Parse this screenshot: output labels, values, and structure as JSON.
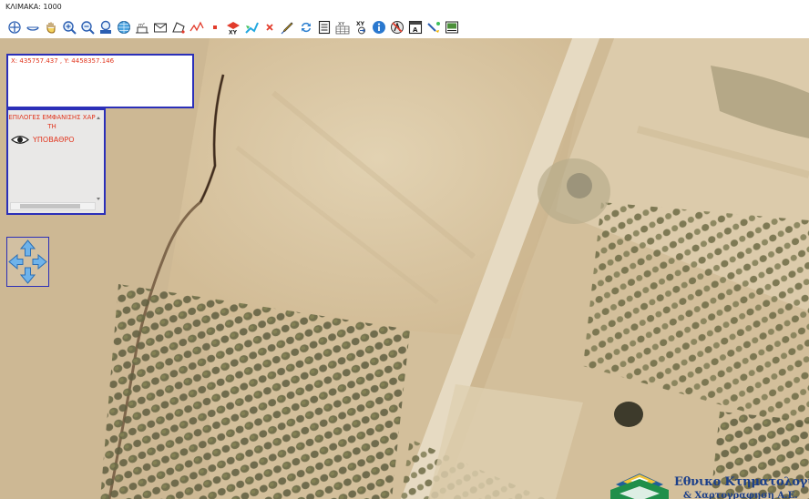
{
  "scale": {
    "text": "ΚΛΙΜΑΚΑ: 1000"
  },
  "toolbar": {
    "tools": [
      "pan-icon",
      "rotate-icon",
      "hand-icon",
      "zoom-in-icon",
      "zoom-out-icon",
      "zoom-previous-icon",
      "globe-icon",
      "measure-area-icon",
      "envelope-icon",
      "polygon-icon",
      "polyline-icon",
      "point-icon",
      "goto-xy-icon",
      "draw-vector-icon",
      "clear-icon",
      "edit-icon",
      "refresh-icon",
      "document-icon",
      "xy-table-icon",
      "xy-export-icon",
      "info-icon",
      "identify-icon",
      "label-icon",
      "style-icon",
      "print-icon"
    ]
  },
  "coords": {
    "text": "X: 435757.437 , Y: 4458357.146"
  },
  "layers": {
    "title": "ΕΠΙΛΟΓΕΣ ΕΜΦΑΝΙΣΗΣ ΧΑΡΤΗ",
    "items": [
      {
        "label": "ΥΠΟΒΑΘΡΟ",
        "visible": true
      }
    ]
  },
  "logo": {
    "line1": "Εθνικο Κτηματολογιο",
    "line2": "& Χαρτογραφηση Α.Ε."
  },
  "colors": {
    "accent_border": "#2b2fb8",
    "text_red": "#e1351e",
    "logo_blue": "#1b3f8a"
  }
}
